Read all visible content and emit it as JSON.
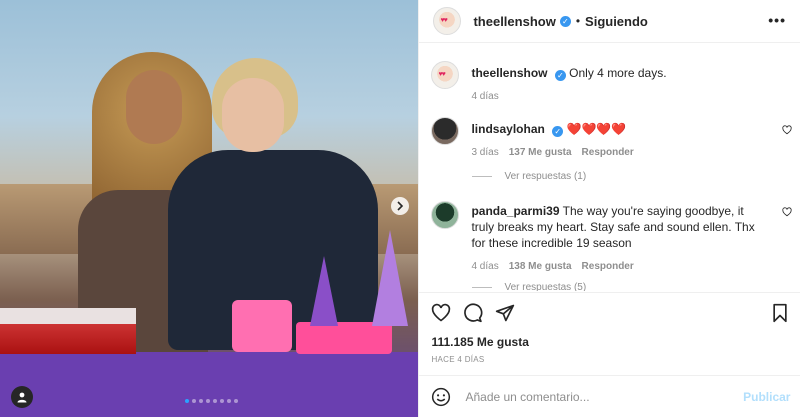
{
  "media": {
    "image_alt": "",
    "carousel": {
      "total": 8,
      "active": 0
    }
  },
  "post_header": {
    "username": "theellenshow",
    "separator": "•",
    "follow_status": "Siguiendo",
    "more_label": "•••"
  },
  "caption": {
    "username": "theellenshow",
    "text": "Only 4 more days.",
    "time": "4 días"
  },
  "comments": [
    {
      "username": "lindsaylohan",
      "verified": true,
      "text": "❤️❤️❤️❤️",
      "time": "3 días",
      "likes": "137 Me gusta",
      "reply": "Responder",
      "view_replies": "Ver respuestas (1)"
    },
    {
      "username": "panda_parmi39",
      "verified": false,
      "text": "The way you're saying goodbye, it truly breaks my heart. Stay safe and sound ellen. Thx for these incredible 19 season",
      "time": "4 días",
      "likes": "138 Me gusta",
      "reply": "Responder",
      "view_replies": "Ver respuestas (5)"
    }
  ],
  "footer": {
    "likes_total": "111.185 Me gusta",
    "date": "HACE 4 DÍAS",
    "comment_placeholder": "Añade un comentario...",
    "publish_label": "Publicar"
  },
  "colors": {
    "accent_blue": "#3897f0",
    "publish_disabled": "#b2dffc",
    "heart_red": "#e0245e"
  }
}
